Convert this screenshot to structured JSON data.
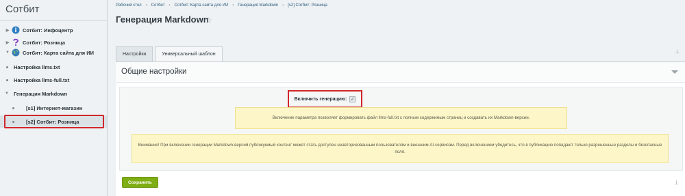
{
  "sidebar": {
    "title": "Сотбит",
    "items": [
      {
        "label": "Сотбит: Инфоцентр",
        "icon": "info-icon"
      },
      {
        "label": "Сотбит: Розница",
        "icon": "question-logo-icon"
      },
      {
        "label": "Сотбит: Карта сайта для ИИ",
        "icon": "globe-icon"
      },
      {
        "label": "Настройка llms.txt"
      },
      {
        "label": "Настройка llms-full.txt"
      },
      {
        "label": "Генерация Markdown"
      },
      {
        "label": "[s1] Интернет-магазин"
      },
      {
        "label": "[s2] Сотбит: Розница"
      }
    ]
  },
  "breadcrumb": [
    "Рабочий стол",
    "Сотбит",
    "Сотбит: Карта сайта для ИИ",
    "Генерация Markdown",
    "[s2] Сотбит: Розница"
  ],
  "page": {
    "title": "Генерация Markdown",
    "star_icon": "☆"
  },
  "tabs": [
    {
      "label": "Настройки",
      "active": true
    },
    {
      "label": "Универсальный шаблон",
      "active": false
    }
  ],
  "section": {
    "title": "Общие настройки"
  },
  "form": {
    "enable_label": "Включить генерацию:",
    "enable_checked": true,
    "enable_check_glyph": "✓"
  },
  "notes": {
    "info": "Включение параметра позволяет формировать файл llms-full.txt с полным содержимым страниц и создавать их Markdown-версии.",
    "warning": "Внимание! При включении генерации Markdown-версий публикуемый контент может стать доступен неавторизованным пользователям и внешним AI-сервисам. Перед включением убедитесь, что в публикацию попадают только разрешенные разделы и безопасные поля."
  },
  "footer": {
    "save_label": "Сохранить"
  },
  "colors": {
    "accent_green": "#7fad14",
    "highlight_red": "#d0262b",
    "note_bg": "#fdf6c8"
  }
}
